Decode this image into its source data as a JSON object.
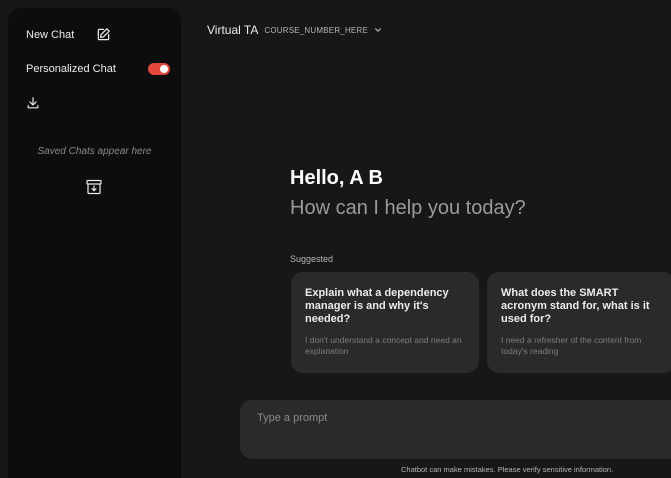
{
  "sidebar": {
    "new_chat_label": "New Chat",
    "new_chat_icon": "edit-icon",
    "personalized_label": "Personalized Chat",
    "personalized_on": true,
    "download_icon": "download-icon",
    "saved_chats_text": "Saved Chats appear here",
    "archive_icon": "archive-icon"
  },
  "header": {
    "title": "Virtual TA",
    "course": "COURSE_NUMBER_HERE",
    "dropdown_icon": "chevron-down-icon"
  },
  "main": {
    "greeting": "Hello, A B",
    "subgreeting": "How can I help you today?",
    "suggested_label": "Suggested",
    "suggestions": [
      {
        "question": "Explain what a dependency manager is and why it's needed?",
        "description": "I don't understand a concept and need an explanation"
      },
      {
        "question": "What does the SMART acronym stand for, what is it used for?",
        "description": "I need a refresher of the content from today's reading"
      }
    ]
  },
  "prompt": {
    "placeholder": "Type a prompt",
    "value": ""
  },
  "footer": {
    "disclaimer": "Chatbot can make mistakes. Please verify sensitive information."
  },
  "colors": {
    "background": "#171717",
    "sidebar": "#0d0d0d",
    "card": "#2a2a2a",
    "toggle_on": "#e4473b"
  }
}
